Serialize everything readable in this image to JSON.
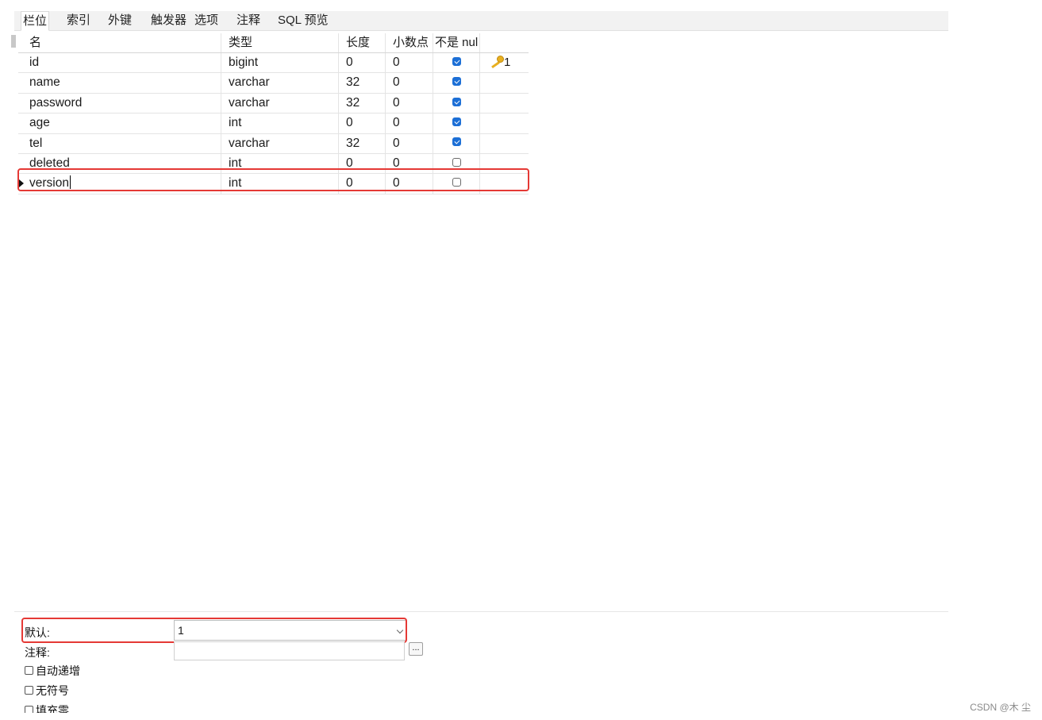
{
  "tabs": [
    {
      "label": "栏位"
    },
    {
      "label": "索引"
    },
    {
      "label": "外键"
    },
    {
      "label": "触发器"
    },
    {
      "label": "选项"
    },
    {
      "label": "注释"
    },
    {
      "label": "SQL 预览"
    }
  ],
  "table": {
    "headers": {
      "name": "名",
      "type": "类型",
      "length": "长度",
      "decimals": "小数点",
      "not_null": "不是 nul",
      "key": ""
    },
    "rows": [
      {
        "name": "id",
        "type": "bigint",
        "length": "0",
        "decimals": "0",
        "not_null": true,
        "key": "1"
      },
      {
        "name": "name",
        "type": "varchar",
        "length": "32",
        "decimals": "0",
        "not_null": true,
        "key": ""
      },
      {
        "name": "password",
        "type": "varchar",
        "length": "32",
        "decimals": "0",
        "not_null": true,
        "key": ""
      },
      {
        "name": "age",
        "type": "int",
        "length": "0",
        "decimals": "0",
        "not_null": true,
        "key": ""
      },
      {
        "name": "tel",
        "type": "varchar",
        "length": "32",
        "decimals": "0",
        "not_null": true,
        "key": ""
      },
      {
        "name": "deleted",
        "type": "int",
        "length": "0",
        "decimals": "0",
        "not_null": false,
        "key": ""
      },
      {
        "name": "version",
        "type": "int",
        "length": "0",
        "decimals": "0",
        "not_null": false,
        "key": ""
      }
    ]
  },
  "properties": {
    "default_label": "默认:",
    "default_value": "1",
    "comment_label": "注释:",
    "comment_button": "...",
    "options": [
      {
        "label": "自动递增",
        "checked": false
      },
      {
        "label": "无符号",
        "checked": false
      },
      {
        "label": "填充零",
        "checked": false
      }
    ]
  },
  "watermark": "CSDN @木 尘",
  "colors": {
    "highlight": "#e53935",
    "checkbox_on": "#1c6fd6",
    "key_icon": "#e8b020"
  }
}
